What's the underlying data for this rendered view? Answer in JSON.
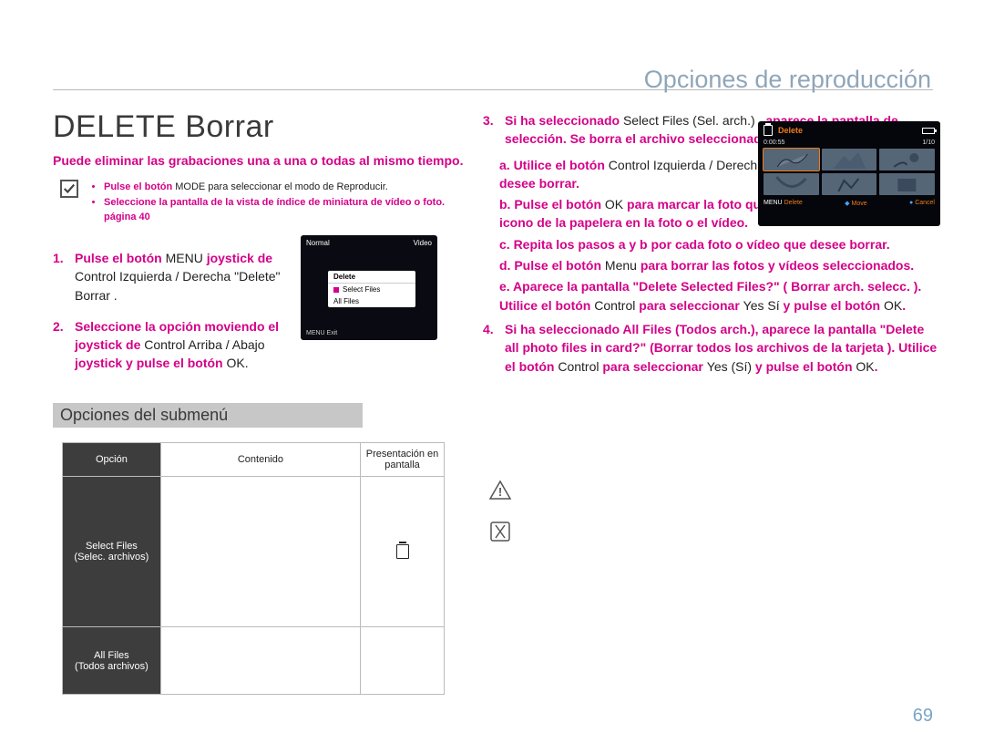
{
  "breadcrumb": "Opciones de reproducción",
  "title": "DELETE Borrar",
  "intro": "Puede eliminar las grabaciones una a una o todas al mismo tiempo.",
  "check": {
    "line1_a": "Pulse el botón",
    "line1_b": " MODE para seleccionar el modo de Reproducir. ",
    "line2_a": "Seleccione la pantalla de la vista de índice de miniatura de vídeo o foto.",
    "page_ref": "  página 40"
  },
  "steps_left": [
    {
      "num": "1.",
      "parts": {
        "a": "Pulse el botón ",
        "b": "MENU ",
        "c": "  joystick de ",
        "d": "Control ",
        "e": "Izquierda / Derecha",
        "f": "  \"Delete\" Borrar ."
      }
    },
    {
      "num": "2.",
      "parts": {
        "a": "Seleccione la opción moviendo el joystick de ",
        "b": "Control ",
        "c": "Arriba / Abajo",
        "d": " joystick y pulse el botón ",
        "e": "OK",
        "f": "."
      }
    }
  ],
  "submenu_label": "Opciones del submenú",
  "table": {
    "headers": {
      "option": "Opción",
      "content": "Contenido",
      "display": "Presentación en pantalla"
    },
    "rows": [
      {
        "opt_a": "Select Files",
        "opt_b": "(Selec. archivos)"
      },
      {
        "opt_a": "All Files",
        "opt_b": "(Todos archivos)"
      }
    ]
  },
  "screenshot": {
    "top_left": "Normal",
    "top_right": "Video",
    "menu_title": "Delete",
    "item1": "Select Files",
    "item2": "All Files",
    "bottom": "MENU Exit"
  },
  "right": {
    "step3_num": "3.",
    "step3": {
      "a": "Si ha seleccionado ",
      "b": "Select Files (Sel. arch.)",
      "c": " , aparece la pantalla de selección. Se borra el archivo seleccionado.",
      "sub_a_p": "a. Utilice el botón ",
      "sub_a_n1": "Control Izquierda / Derecha",
      "sub_a_p2": " para ir a la foto o vídeo que desee borrar.",
      "sub_b_p": "b. Pulse el botón ",
      "sub_b_n": "OK",
      "sub_b_p2": " para marcar la foto que va a borrar. Aparece el icono de la papelera en la foto o el vídeo.",
      "sub_c": "c. Repita los pasos a y b por cada foto o vídeo que desee borrar.",
      "sub_d_p": "d. Pulse el botón ",
      "sub_d_n": "Menu",
      "sub_d_p2": " para borrar las fotos y vídeos seleccionados.",
      "sub_e_p1": "e. Aparece la pantalla \"Delete Selected Files?\" ( Borrar arch. selecc. ). Utilice el botón ",
      "sub_e_n1": "Control",
      "sub_e_p2": " para seleccionar ",
      "sub_e_n2": "Yes Sí",
      "sub_e_p3": " y pulse el botón ",
      "sub_e_n3": "OK",
      "sub_e_p4": "."
    },
    "step4_num": "4.",
    "step4": {
      "a": "Si ha seleccionado All Files (Todos arch.), aparece la pantalla \"Delete all photo files in card?\" (Borrar todos los archivos de la tarjeta ). Utilice el botón ",
      "b": "Control",
      "c": " para seleccionar ",
      "d": "Yes (Sí)",
      "e": " y pulse el botón ",
      "f": "OK",
      "g": "."
    }
  },
  "thumb": {
    "title": "Delete",
    "time": "0:00:55",
    "counter": "1/10",
    "menu": "MENU",
    "delete_lbl": "Delete",
    "move": "Move",
    "cancel": "Cancel"
  },
  "page_number": "69"
}
